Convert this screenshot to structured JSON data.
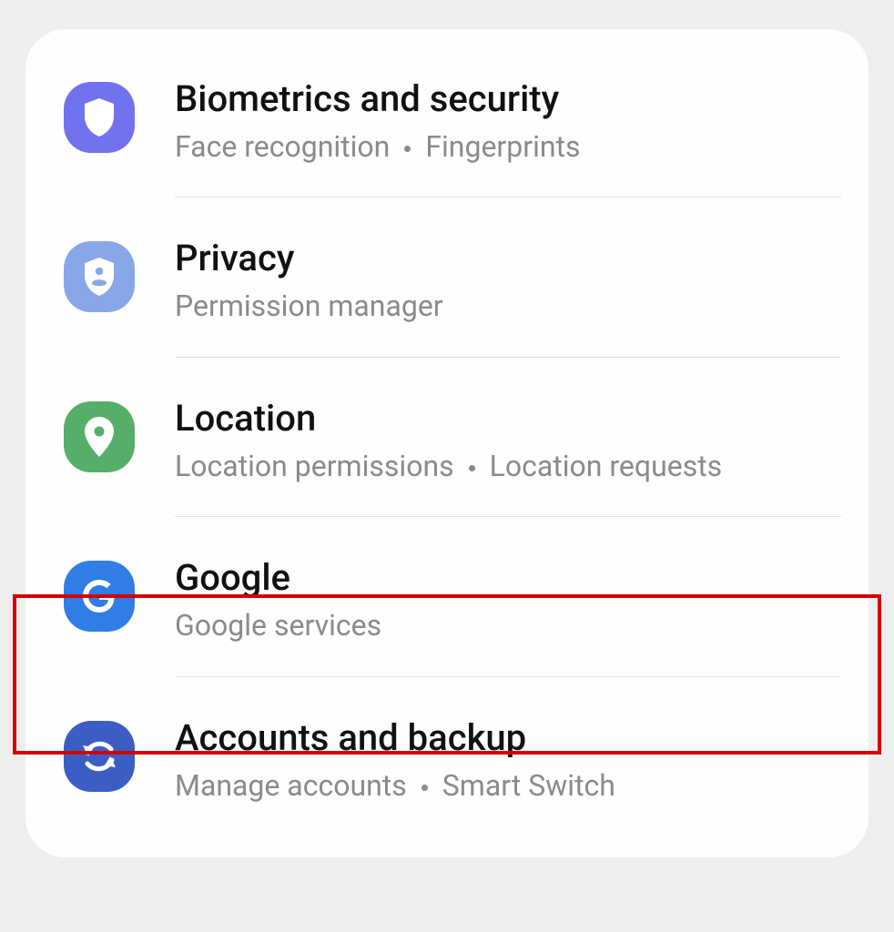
{
  "settings": [
    {
      "id": "biometrics",
      "title": "Biometrics and security",
      "sub": [
        "Face recognition",
        "Fingerprints"
      ],
      "iconBg": "#7272ee",
      "highlighted": false
    },
    {
      "id": "privacy",
      "title": "Privacy",
      "sub": [
        "Permission manager"
      ],
      "iconBg": "#88a7e8",
      "highlighted": false
    },
    {
      "id": "location",
      "title": "Location",
      "sub": [
        "Location permissions",
        "Location requests"
      ],
      "iconBg": "#55af69",
      "highlighted": false
    },
    {
      "id": "google",
      "title": "Google",
      "sub": [
        "Google services"
      ],
      "iconBg": "#2f7de5",
      "highlighted": true
    },
    {
      "id": "accounts",
      "title": "Accounts and backup",
      "sub": [
        "Manage accounts",
        "Smart Switch"
      ],
      "iconBg": "#3a5ec3",
      "highlighted": false
    }
  ]
}
